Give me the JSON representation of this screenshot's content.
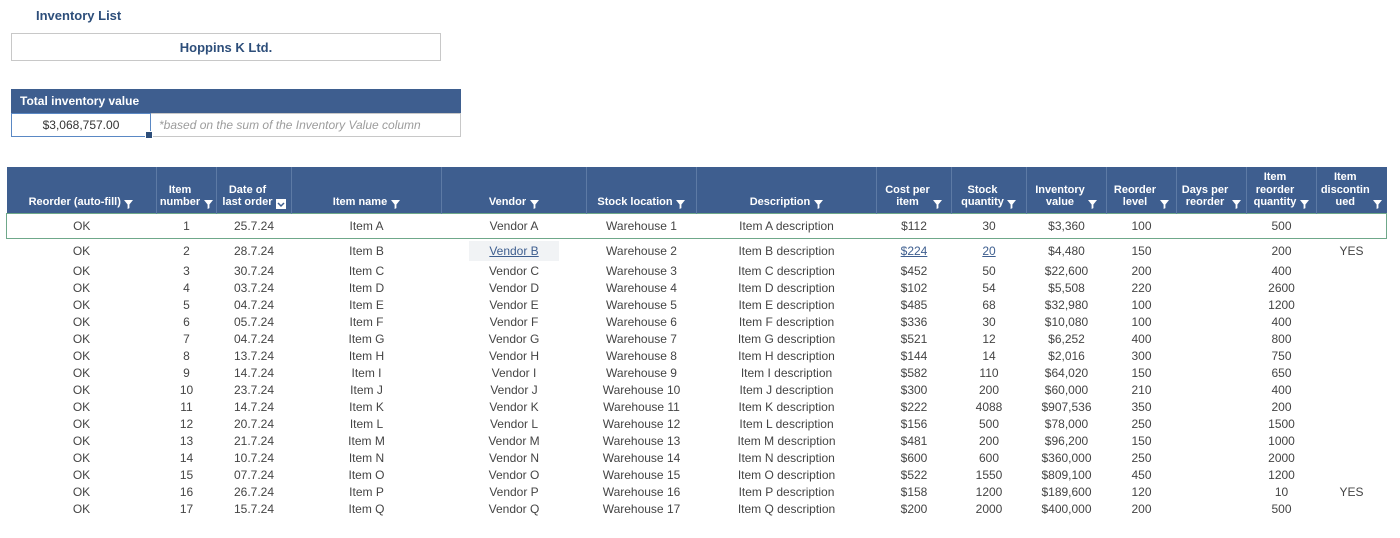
{
  "title": "Inventory List",
  "company": "Hoppins K Ltd.",
  "total": {
    "header": "Total inventory value",
    "value": "$3,068,757.00",
    "note": "*based on the sum of the Inventory Value column"
  },
  "columns": [
    {
      "key": "reorder",
      "label": "Reorder (auto-fill)",
      "filter": "funnel"
    },
    {
      "key": "itemno",
      "label": "Item number",
      "filter": "funnel"
    },
    {
      "key": "date",
      "label": "Date of last order",
      "filter": "box"
    },
    {
      "key": "name",
      "label": "Item name",
      "filter": "funnel"
    },
    {
      "key": "vendor",
      "label": "Vendor",
      "filter": "funnel"
    },
    {
      "key": "stockloc",
      "label": "Stock location",
      "filter": "funnel"
    },
    {
      "key": "desc",
      "label": "Description",
      "filter": "funnel"
    },
    {
      "key": "cost",
      "label": "Cost per item",
      "filter": "funnel"
    },
    {
      "key": "stockqty",
      "label": "Stock quantity",
      "filter": "funnel"
    },
    {
      "key": "invval",
      "label": "Inventory value",
      "filter": "funnel"
    },
    {
      "key": "reordlvl",
      "label": "Reorder level",
      "filter": "funnel"
    },
    {
      "key": "days",
      "label": "Days per reorder",
      "filter": "funnel"
    },
    {
      "key": "reordqty",
      "label": "Item reorder quantity",
      "filter": "funnel"
    },
    {
      "key": "disc",
      "label": "Item discontin\nued",
      "filter": "funnel"
    }
  ],
  "rows": [
    {
      "reorder": "OK",
      "itemno": "1",
      "date": "25.7.24",
      "name": "Item A",
      "vendor": "Vendor A",
      "stockloc": "Warehouse 1",
      "desc": "Item A description",
      "cost": "$112",
      "stockqty": "30",
      "invval": "$3,360",
      "reordlvl": "100",
      "days": "",
      "reordqty": "500",
      "disc": ""
    },
    {
      "reorder": "OK",
      "itemno": "2",
      "date": "28.7.24",
      "name": "Item B",
      "vendor": "Vendor B",
      "stockloc": "Warehouse 2",
      "desc": "Item B description",
      "cost": "$224",
      "stockqty": "20",
      "invval": "$4,480",
      "reordlvl": "150",
      "days": "",
      "reordqty": "200",
      "disc": "YES"
    },
    {
      "reorder": "OK",
      "itemno": "3",
      "date": "30.7.24",
      "name": "Item C",
      "vendor": "Vendor C",
      "stockloc": "Warehouse 3",
      "desc": "Item C description",
      "cost": "$452",
      "stockqty": "50",
      "invval": "$22,600",
      "reordlvl": "200",
      "days": "",
      "reordqty": "400",
      "disc": ""
    },
    {
      "reorder": "OK",
      "itemno": "4",
      "date": "03.7.24",
      "name": "Item D",
      "vendor": "Vendor D",
      "stockloc": "Warehouse 4",
      "desc": "Item D description",
      "cost": "$102",
      "stockqty": "54",
      "invval": "$5,508",
      "reordlvl": "220",
      "days": "",
      "reordqty": "2600",
      "disc": ""
    },
    {
      "reorder": "OK",
      "itemno": "5",
      "date": "04.7.24",
      "name": "Item E",
      "vendor": "Vendor E",
      "stockloc": "Warehouse 5",
      "desc": "Item E description",
      "cost": "$485",
      "stockqty": "68",
      "invval": "$32,980",
      "reordlvl": "100",
      "days": "",
      "reordqty": "1200",
      "disc": ""
    },
    {
      "reorder": "OK",
      "itemno": "6",
      "date": "05.7.24",
      "name": "Item F",
      "vendor": "Vendor F",
      "stockloc": "Warehouse 6",
      "desc": "Item F description",
      "cost": "$336",
      "stockqty": "30",
      "invval": "$10,080",
      "reordlvl": "100",
      "days": "",
      "reordqty": "400",
      "disc": ""
    },
    {
      "reorder": "OK",
      "itemno": "7",
      "date": "04.7.24",
      "name": "Item G",
      "vendor": "Vendor G",
      "stockloc": "Warehouse 7",
      "desc": "Item G description",
      "cost": "$521",
      "stockqty": "12",
      "invval": "$6,252",
      "reordlvl": "400",
      "days": "",
      "reordqty": "800",
      "disc": ""
    },
    {
      "reorder": "OK",
      "itemno": "8",
      "date": "13.7.24",
      "name": "Item H",
      "vendor": "Vendor H",
      "stockloc": "Warehouse 8",
      "desc": "Item H description",
      "cost": "$144",
      "stockqty": "14",
      "invval": "$2,016",
      "reordlvl": "300",
      "days": "",
      "reordqty": "750",
      "disc": ""
    },
    {
      "reorder": "OK",
      "itemno": "9",
      "date": "14.7.24",
      "name": "Item I",
      "vendor": "Vendor I",
      "stockloc": "Warehouse 9",
      "desc": "Item I description",
      "cost": "$582",
      "stockqty": "110",
      "invval": "$64,020",
      "reordlvl": "150",
      "days": "",
      "reordqty": "650",
      "disc": ""
    },
    {
      "reorder": "OK",
      "itemno": "10",
      "date": "23.7.24",
      "name": "Item J",
      "vendor": "Vendor J",
      "stockloc": "Warehouse 10",
      "desc": "Item J description",
      "cost": "$300",
      "stockqty": "200",
      "invval": "$60,000",
      "reordlvl": "210",
      "days": "",
      "reordqty": "400",
      "disc": ""
    },
    {
      "reorder": "OK",
      "itemno": "11",
      "date": "14.7.24",
      "name": "Item K",
      "vendor": "Vendor K",
      "stockloc": "Warehouse 11",
      "desc": "Item K description",
      "cost": "$222",
      "stockqty": "4088",
      "invval": "$907,536",
      "reordlvl": "350",
      "days": "",
      "reordqty": "200",
      "disc": ""
    },
    {
      "reorder": "OK",
      "itemno": "12",
      "date": "20.7.24",
      "name": "Item L",
      "vendor": "Vendor L",
      "stockloc": "Warehouse 12",
      "desc": "Item L description",
      "cost": "$156",
      "stockqty": "500",
      "invval": "$78,000",
      "reordlvl": "250",
      "days": "",
      "reordqty": "1500",
      "disc": ""
    },
    {
      "reorder": "OK",
      "itemno": "13",
      "date": "21.7.24",
      "name": "Item M",
      "vendor": "Vendor M",
      "stockloc": "Warehouse 13",
      "desc": "Item M description",
      "cost": "$481",
      "stockqty": "200",
      "invval": "$96,200",
      "reordlvl": "150",
      "days": "",
      "reordqty": "1000",
      "disc": ""
    },
    {
      "reorder": "OK",
      "itemno": "14",
      "date": "10.7.24",
      "name": "Item N",
      "vendor": "Vendor N",
      "stockloc": "Warehouse 14",
      "desc": "Item N description",
      "cost": "$600",
      "stockqty": "600",
      "invval": "$360,000",
      "reordlvl": "250",
      "days": "",
      "reordqty": "2000",
      "disc": ""
    },
    {
      "reorder": "OK",
      "itemno": "15",
      "date": "07.7.24",
      "name": "Item O",
      "vendor": "Vendor O",
      "stockloc": "Warehouse 15",
      "desc": "Item O description",
      "cost": "$522",
      "stockqty": "1550",
      "invval": "$809,100",
      "reordlvl": "450",
      "days": "",
      "reordqty": "1200",
      "disc": ""
    },
    {
      "reorder": "OK",
      "itemno": "16",
      "date": "26.7.24",
      "name": "Item P",
      "vendor": "Vendor P",
      "stockloc": "Warehouse 16",
      "desc": "Item P description",
      "cost": "$158",
      "stockqty": "1200",
      "invval": "$189,600",
      "reordlvl": "120",
      "days": "",
      "reordqty": "10",
      "disc": "YES"
    },
    {
      "reorder": "OK",
      "itemno": "17",
      "date": "15.7.24",
      "name": "Item Q",
      "vendor": "Vendor Q",
      "stockloc": "Warehouse 17",
      "desc": "Item Q description",
      "cost": "$200",
      "stockqty": "2000",
      "invval": "$400,000",
      "reordlvl": "200",
      "days": "",
      "reordqty": "500",
      "disc": ""
    }
  ]
}
